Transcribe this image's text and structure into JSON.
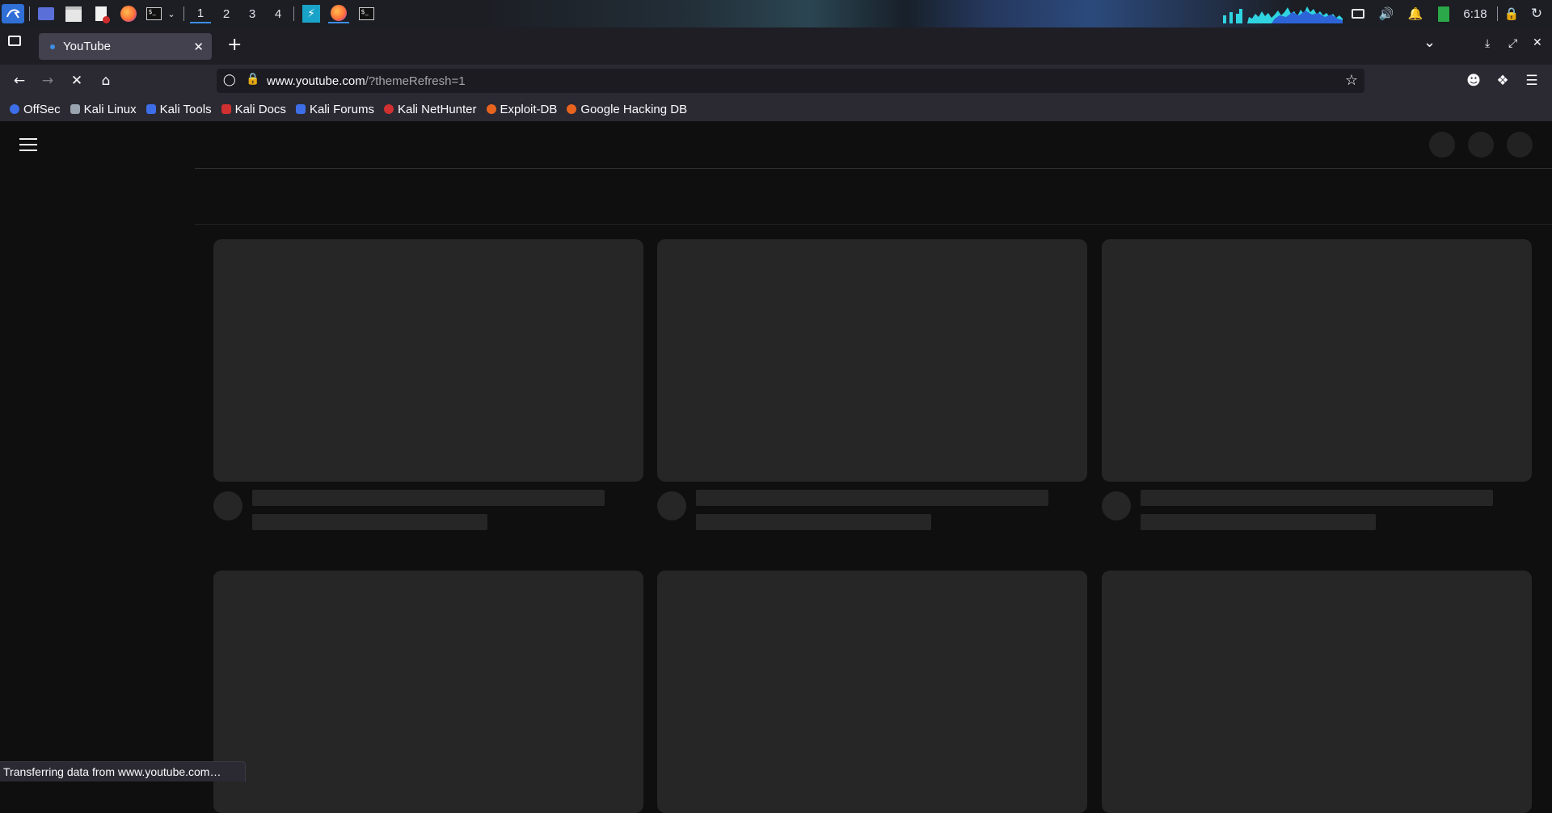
{
  "taskbar": {
    "workspaces": [
      "1",
      "2",
      "3",
      "4"
    ],
    "active_workspace": "1",
    "clock": "6:18"
  },
  "browser": {
    "tab_title": "YouTube",
    "url_host": "www.youtube.com",
    "url_path": "/?themeRefresh=1",
    "bookmarks": [
      {
        "label": "OffSec",
        "color": "#3d6ee8"
      },
      {
        "label": "Kali Linux",
        "color": "#9aa3b0"
      },
      {
        "label": "Kali Tools",
        "color": "#3d6ee8"
      },
      {
        "label": "Kali Docs",
        "color": "#d03030"
      },
      {
        "label": "Kali Forums",
        "color": "#3d6ee8"
      },
      {
        "label": "Kali NetHunter",
        "color": "#d03030"
      },
      {
        "label": "Exploit-DB",
        "color": "#e8641e"
      },
      {
        "label": "Google Hacking DB",
        "color": "#e8641e"
      }
    ],
    "status_text": "Transferring data from www.youtube.com…"
  },
  "colors": {
    "accent": "#3d8ee8",
    "skeleton": "#262626",
    "page_bg": "#0f0f0f"
  }
}
